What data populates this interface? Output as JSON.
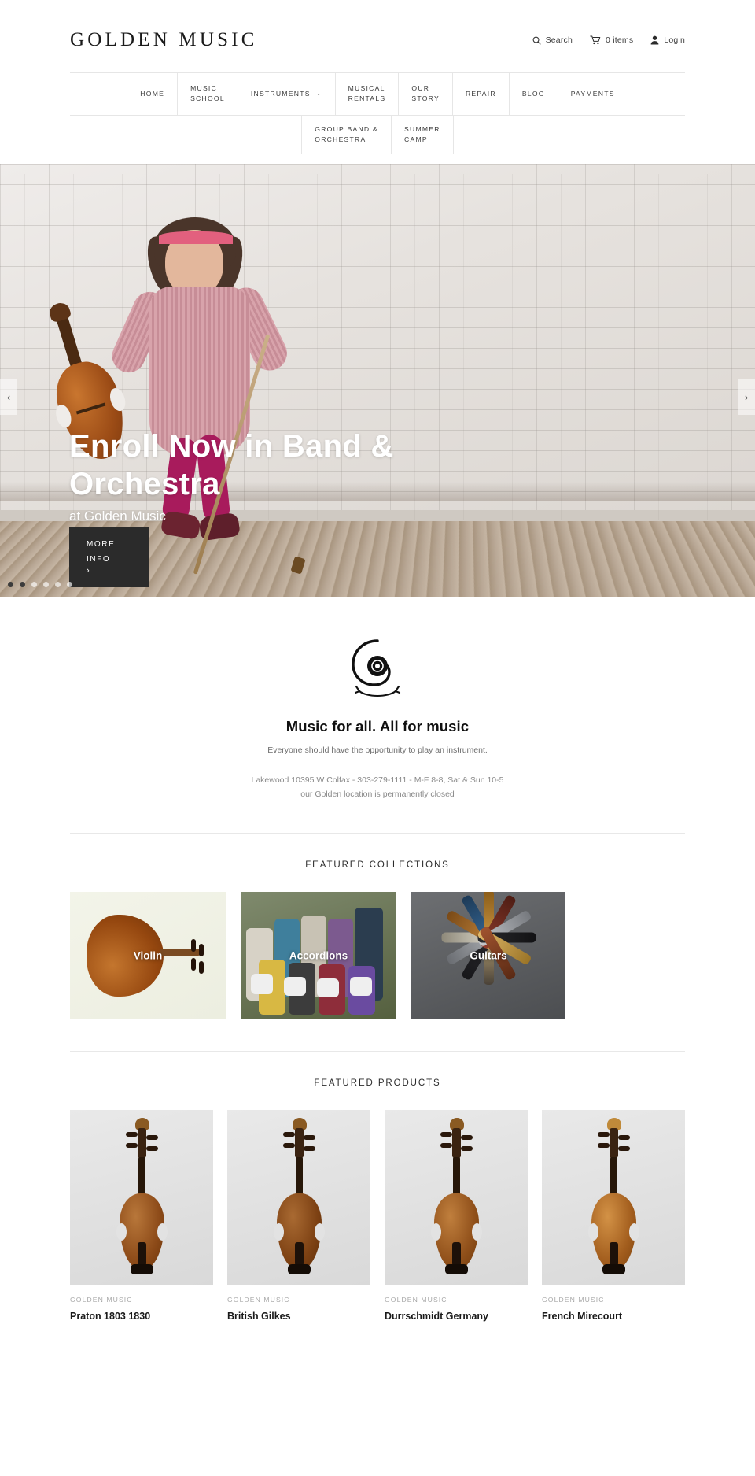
{
  "header": {
    "logo": "GOLDEN MUSIC",
    "tools": [
      {
        "icon": "search-icon",
        "label": "Search"
      },
      {
        "icon": "cart-icon",
        "label": "0 items"
      },
      {
        "icon": "user-icon",
        "label": "Login"
      }
    ]
  },
  "nav": {
    "row1": [
      {
        "label": "HOME",
        "caret": ""
      },
      {
        "label": "MUSIC\nSCHOOL",
        "caret": ""
      },
      {
        "label": "INSTRUMENTS",
        "caret": "⌄"
      },
      {
        "label": "MUSICAL\nRENTALS",
        "caret": ""
      },
      {
        "label": "OUR\nSTORY",
        "caret": ""
      },
      {
        "label": "REPAIR",
        "caret": ""
      },
      {
        "label": "BLOG",
        "caret": ""
      },
      {
        "label": "PAYMENTS",
        "caret": ""
      }
    ],
    "row2": [
      {
        "label": "GROUP BAND &\nORCHESTRA",
        "caret": ""
      },
      {
        "label": "SUMMER\nCAMP",
        "caret": ""
      }
    ]
  },
  "hero": {
    "title": "Enroll Now in Band & Orchestra",
    "subtitle": "at Golden Music",
    "button_label": "MORE INFO",
    "button_arrow": "›",
    "prev_arrow": "‹",
    "next_arrow": "›",
    "slide_count": 6,
    "active_slide": 2
  },
  "brand": {
    "tagline": "Music for all. All for music",
    "tagline_sub": "Everyone should have the opportunity to play an instrument.",
    "info_line_1": "Lakewood 10395 W Colfax - 303-279-1111 - M-F 8-8, Sat & Sun 10-5",
    "info_line_2": "our Golden location is permanently closed"
  },
  "collections": {
    "title": "FEATURED COLLECTIONS",
    "items": [
      {
        "label": "Violin"
      },
      {
        "label": "Accordions"
      },
      {
        "label": "Guitars"
      }
    ]
  },
  "products": {
    "title": "FEATURED PRODUCTS",
    "items": [
      {
        "vendor": "GOLDEN MUSIC",
        "title": "Praton 1803 1830"
      },
      {
        "vendor": "GOLDEN MUSIC",
        "title": "British Gilkes"
      },
      {
        "vendor": "GOLDEN MUSIC",
        "title": "Durrschmidt Germany"
      },
      {
        "vendor": "GOLDEN MUSIC",
        "title": "French Mirecourt"
      }
    ]
  },
  "colors": {
    "accent_dark": "#2b2b2b",
    "text": "#2b2b2b",
    "muted": "#8a8a8a",
    "border": "#e6e6e6"
  }
}
